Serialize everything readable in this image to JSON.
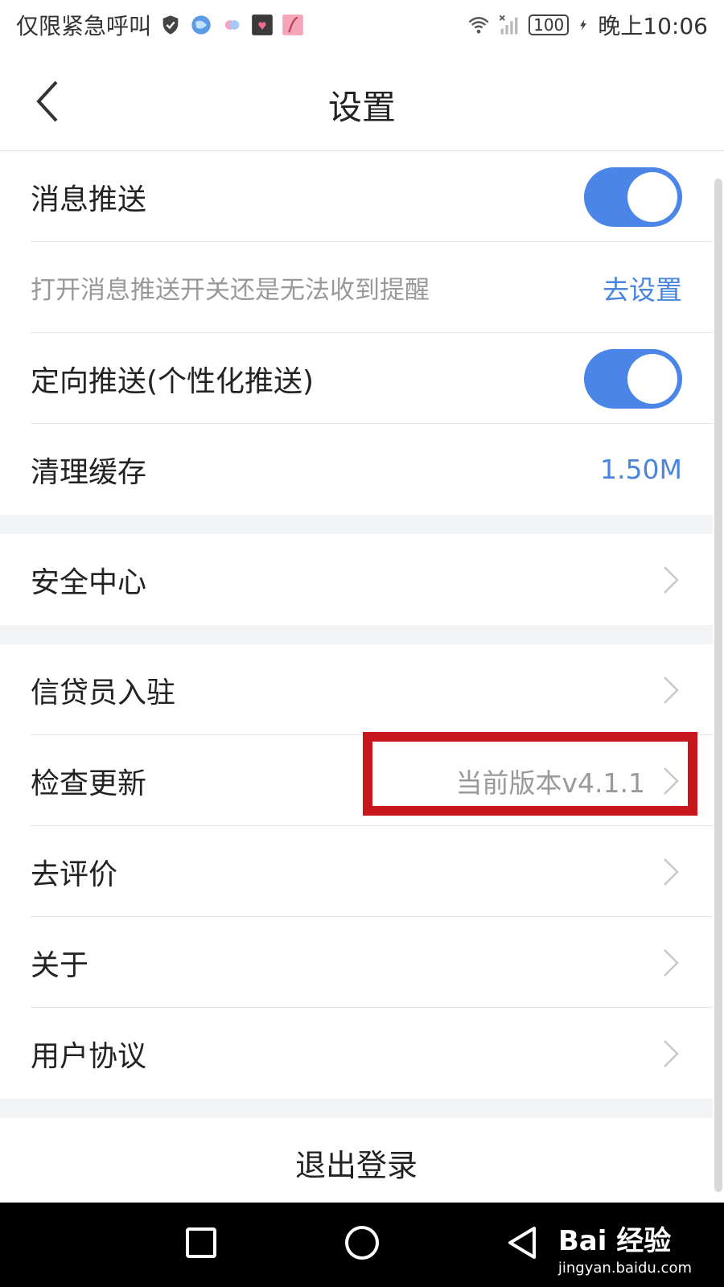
{
  "status_bar": {
    "carrier": "仅限紧急呼叫",
    "battery": "100",
    "time": "晚上10:06",
    "icons": [
      "shield-icon",
      "browser-icon",
      "app-icon",
      "photo-icon",
      "photo-icon",
      "wifi-icon",
      "signal-icon",
      "battery-icon",
      "charging-icon"
    ]
  },
  "header": {
    "title": "设置",
    "back_icon": "back-arrow-icon"
  },
  "rows": {
    "push": {
      "label": "消息推送",
      "toggle_on": true
    },
    "push_hint": {
      "label": "打开消息推送开关还是无法收到提醒",
      "link": "去设置"
    },
    "targeted_push": {
      "label": "定向推送(个性化推送)",
      "toggle_on": true
    },
    "clear_cache": {
      "label": "清理缓存",
      "value": "1.50M"
    },
    "security": {
      "label": "安全中心"
    },
    "loan_officer": {
      "label": "信贷员入驻"
    },
    "check_update": {
      "label": "检查更新",
      "value": "当前版本v4.1.1"
    },
    "rate": {
      "label": "去评价"
    },
    "about": {
      "label": "关于"
    },
    "agreement": {
      "label": "用户协议"
    }
  },
  "logout": {
    "label": "退出登录"
  },
  "watermark": {
    "brand": "Bai 经验",
    "url": "jingyan.baidu.com"
  },
  "colors": {
    "accent": "#4b85e7",
    "highlight": "#c8161d",
    "nav_bg": "#000000"
  }
}
